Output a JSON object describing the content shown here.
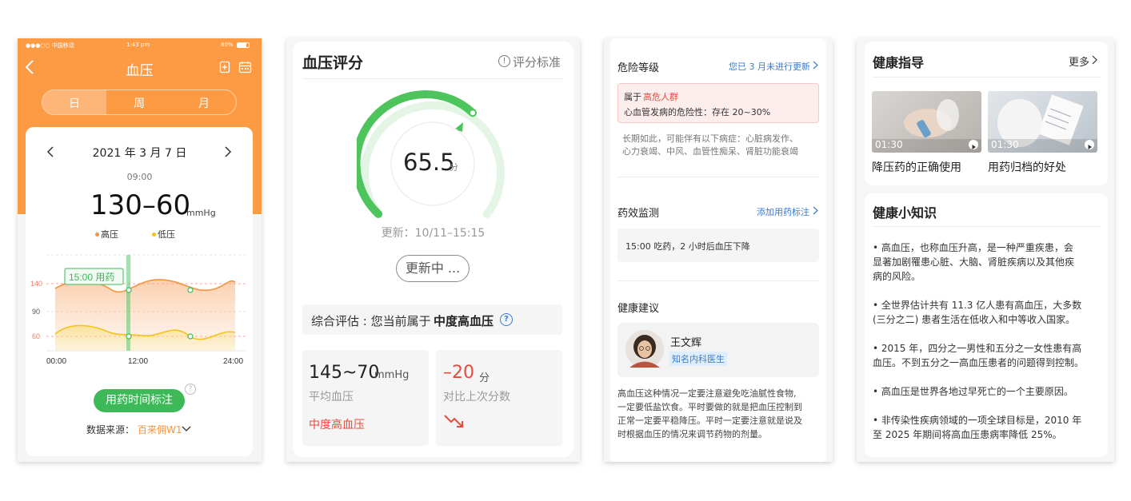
{
  "panel1": {
    "status": {
      "carrier": "●●●○○ 中国移动",
      "time": "1:43 pm",
      "battery": "80%"
    },
    "nav": {
      "title": "血压"
    },
    "segments": [
      "日",
      "周",
      "月"
    ],
    "date": "2021 年 3 月 7 日",
    "reading_time": "09:00",
    "reading_value": "130–60",
    "reading_unit": "mmHg",
    "legend": [
      {
        "label": "高压",
        "color": "#f5923e"
      },
      {
        "label": "低压",
        "color": "#f3c316"
      }
    ],
    "chart": {
      "y_ticks": [
        "140",
        "90",
        "60"
      ],
      "x_ticks": [
        "00:00",
        "12:00",
        "24:00"
      ],
      "marker_label": "15:00 用药"
    },
    "med_button": "用药时间标注",
    "source_label": "数据来源：",
    "source_device": "百来佣W1"
  },
  "panel2": {
    "title": "血压评分",
    "criteria": "评分标准",
    "score": "65.5",
    "score_unit": "分",
    "gauge_fraction": 0.655,
    "updated": "更新：10/11–15:15",
    "updating_button": "更新中 ...",
    "summary_prefix": "综合评估 : 您当前属于",
    "summary_level": "中度高血压",
    "avg_value": "145~70",
    "avg_unit": "mmHg",
    "avg_label": "平均血压",
    "avg_status": "中度高血压",
    "diff_value": "–20",
    "diff_unit": "分",
    "diff_label": "对比上次分数"
  },
  "panel3": {
    "risk_title": "危险等级",
    "risk_link": "您已 3 月未进行更新",
    "risk_line1_prefix": "属于",
    "risk_line1_level": "高危人群",
    "risk_line2": "心血管发病的危险性：存在 20~30%",
    "risk_desc_1": "长期如此，可能伴有以下病症：心脏病发作、",
    "risk_desc_2": "心力衰竭、中风、血管性痴呆、肾脏功能衰竭",
    "effect_title": "药效监测",
    "effect_link": "添加用药标注",
    "effect_text": "15:00 吃药，2 小时后血压下降",
    "advice_title": "健康建议",
    "doctor_name": "王文辉",
    "doctor_tag": "知名内科医生",
    "advice_lines": [
      "高血压这种情况一定要注意避免吃油腻性食物,",
      "一定要低盐饮食。平时要做的就是把血压控制到",
      "正常一定要平稳降压。平时一定要注意就是说及",
      "时根据血压的情况来调节药物的剂量。"
    ]
  },
  "panel4": {
    "guide_title": "健康指导",
    "more": "更多",
    "videos": [
      {
        "duration": "01:30",
        "caption": "降压药的正确使用"
      },
      {
        "duration": "01:30",
        "caption": "用药归档的好处"
      }
    ],
    "knowledge_title": "健康小知识",
    "knowledge": [
      [
        "• 高血压，也称血压升高，是一种严重疾患，会",
        "显著加剧罹患心脏、大脑、肾脏疾病以及其他疾",
        "病的风险。"
      ],
      [
        "• 全世界估计共有 11.3 亿人患有高血压，大多数",
        "(三分之二) 患者生活在低收入和中等收入国家。"
      ],
      [
        "• 2015 年，四分之一男性和五分之一女性患有高",
        "血压。不到五分之一高血压患者的问题得到控制。"
      ],
      [
        "• 高血压是世界各地过早死亡的一个主要原因。"
      ],
      [
        "• 非传染性疾病领域的一项全球目标是，2010 年",
        "至 2025 年期间将高血压患病率降低 25%。"
      ]
    ]
  }
}
